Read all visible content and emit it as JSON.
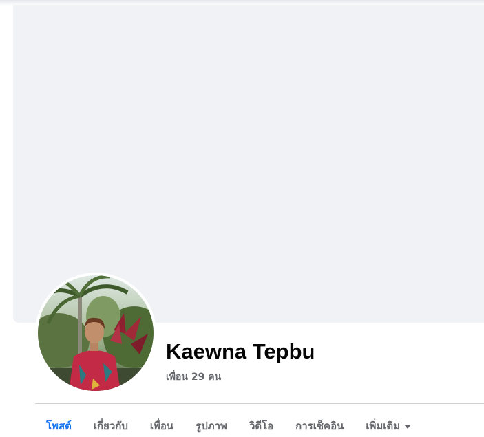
{
  "profile": {
    "name": "Kaewna Tepbu",
    "friends_text": "เพื่อน 29 คน"
  },
  "tabs": [
    {
      "label": "โพสต์",
      "active": true
    },
    {
      "label": "เกี่ยวกับ",
      "active": false
    },
    {
      "label": "เพื่อน",
      "active": false
    },
    {
      "label": "รูปภาพ",
      "active": false
    },
    {
      "label": "วิดีโอ",
      "active": false
    },
    {
      "label": "การเช็คอิน",
      "active": false
    },
    {
      "label": "เพิ่มเติม",
      "active": false,
      "icon": "caret-down-icon"
    }
  ],
  "colors": {
    "accent": "#1877f2",
    "cover_bg": "#f0f2f5",
    "secondary_text": "#65676b"
  }
}
